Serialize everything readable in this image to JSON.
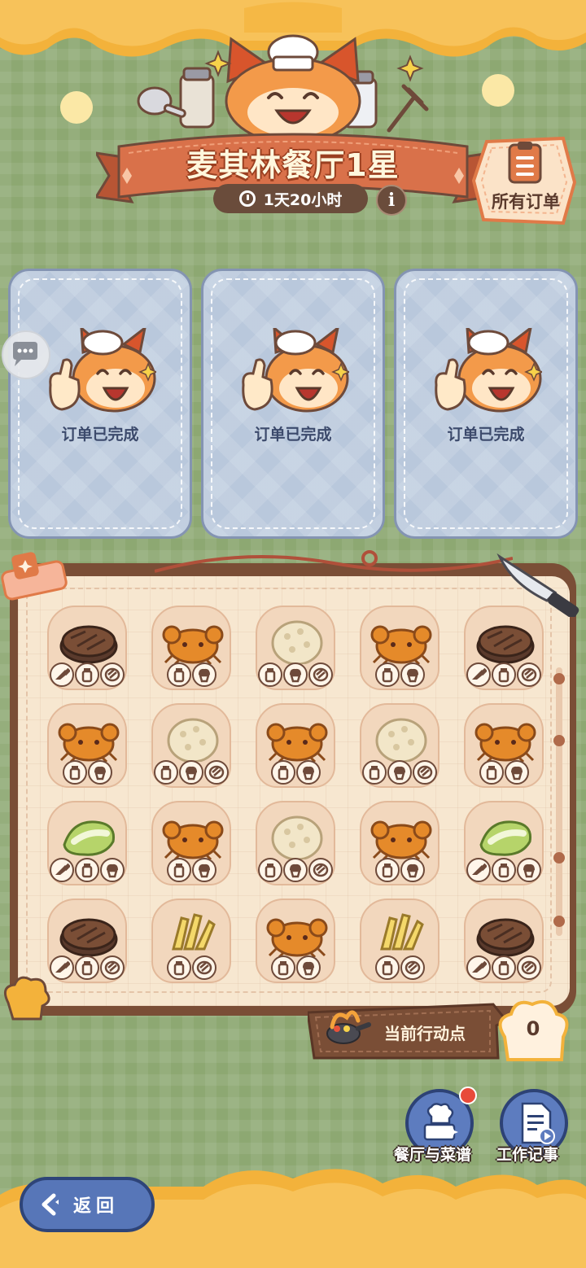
{
  "header": {
    "title": "麦其林餐厅1星",
    "timer": "1天20小时",
    "info_icon": "i",
    "all_orders_label": "所有订单"
  },
  "orders": [
    {
      "status": "订单已完成"
    },
    {
      "status": "订单已完成"
    },
    {
      "status": "订单已完成"
    }
  ],
  "board": {
    "rows": [
      [
        {
          "food": "steak",
          "tools": [
            "knife",
            "shaker",
            "grill"
          ]
        },
        {
          "food": "crab",
          "tools": [
            "shaker",
            "muffin"
          ]
        },
        {
          "food": "rice",
          "tools": [
            "shaker",
            "muffin",
            "grill"
          ]
        },
        {
          "food": "crab",
          "tools": [
            "shaker",
            "muffin"
          ]
        },
        {
          "food": "steak",
          "tools": [
            "knife",
            "shaker",
            "grill"
          ]
        }
      ],
      [
        {
          "food": "crab",
          "tools": [
            "shaker",
            "muffin"
          ]
        },
        {
          "food": "rice",
          "tools": [
            "shaker",
            "muffin",
            "grill"
          ]
        },
        {
          "food": "crab",
          "tools": [
            "shaker",
            "muffin"
          ]
        },
        {
          "food": "rice",
          "tools": [
            "shaker",
            "muffin",
            "grill"
          ]
        },
        {
          "food": "crab",
          "tools": [
            "shaker",
            "muffin"
          ]
        }
      ],
      [
        {
          "food": "cabbage",
          "tools": [
            "knife",
            "shaker",
            "muffin"
          ]
        },
        {
          "food": "crab",
          "tools": [
            "shaker",
            "muffin"
          ]
        },
        {
          "food": "rice",
          "tools": [
            "shaker",
            "muffin",
            "grill"
          ]
        },
        {
          "food": "crab",
          "tools": [
            "shaker",
            "muffin"
          ]
        },
        {
          "food": "cabbage",
          "tools": [
            "knife",
            "shaker",
            "muffin"
          ]
        }
      ],
      [
        {
          "food": "steak",
          "tools": [
            "knife",
            "shaker",
            "grill"
          ]
        },
        {
          "food": "fries",
          "tools": [
            "shaker",
            "grill"
          ]
        },
        {
          "food": "crab",
          "tools": [
            "shaker",
            "muffin"
          ]
        },
        {
          "food": "fries",
          "tools": [
            "shaker",
            "grill"
          ]
        },
        {
          "food": "steak",
          "tools": [
            "knife",
            "shaker",
            "grill"
          ]
        }
      ]
    ]
  },
  "action_points": {
    "label": "当前行动点",
    "value": "0"
  },
  "buttons": {
    "restaurant_recipes": "餐厅与菜谱",
    "work_notes": "工作记事",
    "back": "返回"
  },
  "colors": {
    "background": "#8da872",
    "banner": "#d9714a",
    "card": "#b9c8dc",
    "board": "#f7e7d0",
    "button_blue": "#5776b8"
  }
}
